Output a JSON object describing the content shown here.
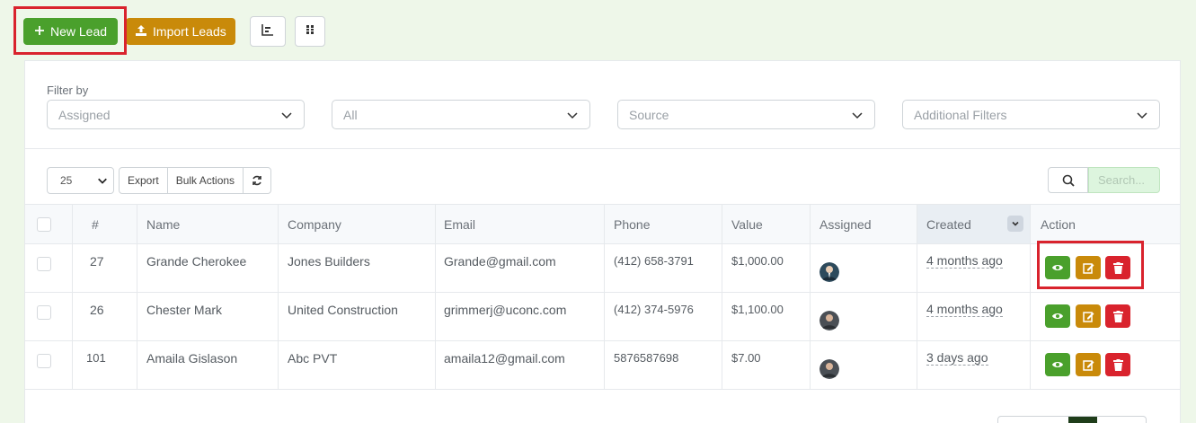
{
  "toolbar": {
    "new_lead_label": "New Lead",
    "import_leads_label": "Import Leads",
    "icon_buttons": [
      "chart-icon",
      "grid-icon"
    ]
  },
  "filters": {
    "label": "Filter by",
    "selects": [
      {
        "placeholder": "Assigned"
      },
      {
        "placeholder": "All"
      },
      {
        "placeholder": "Source"
      },
      {
        "placeholder": "Additional Filters"
      }
    ]
  },
  "table_controls": {
    "page_length": "25",
    "export_label": "Export",
    "bulk_actions_label": "Bulk Actions",
    "search_placeholder": "Search..."
  },
  "table": {
    "columns": [
      "#",
      "Name",
      "Company",
      "Email",
      "Phone",
      "Value",
      "Assigned",
      "Created",
      "Action"
    ],
    "rows": [
      {
        "id": "27",
        "name": "Grande Cherokee",
        "company": "Jones Builders",
        "email": "Grande@gmail.com",
        "phone": "(412) 658-3791",
        "value": "$1,000.00",
        "created": "4 months ago"
      },
      {
        "id": "26",
        "name": "Chester Mark",
        "company": "United Construction",
        "email": "grimmerj@uconc.com",
        "phone": "(412) 374-5976",
        "value": "$1,100.00",
        "created": "4 months ago"
      },
      {
        "id": "101",
        "name": "Amaila Gislason",
        "company": "Abc PVT",
        "email": "amaila12@gmail.com",
        "phone": "5876587698",
        "value": "$7.00",
        "created": "3 days ago"
      }
    ]
  },
  "colors": {
    "primary_green": "#4aa02c",
    "warning_orange": "#c98a0a",
    "danger_red": "#d9232d",
    "page_bg": "#eef7e9"
  }
}
